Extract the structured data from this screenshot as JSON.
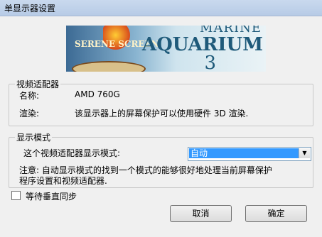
{
  "window": {
    "title": "单显示器设置"
  },
  "banner": {
    "serene_text": "SERENE SCREEN",
    "title_top": "MARINE",
    "title_main": "AQUARIUM",
    "title_num": "3"
  },
  "adapter": {
    "legend": "视频适配器",
    "name_label": "名称:",
    "name_value": "AMD 760G",
    "render_label": "渲染:",
    "render_value": "该显示器上的屏幕保护可以使用硬件 3D 渲染."
  },
  "display_mode": {
    "legend": "显示模式",
    "mode_label": "这个视频适配器显示模式:",
    "selected": "自动",
    "note_line1": "注意: 自动显示模式的找到一个模式的能够很好地处理当前屏幕保护",
    "note_line2": "程序设置和视频适配器."
  },
  "vsync": {
    "label": "等待垂直同步",
    "checked": false
  },
  "buttons": {
    "cancel": "取消",
    "ok": "确定"
  }
}
